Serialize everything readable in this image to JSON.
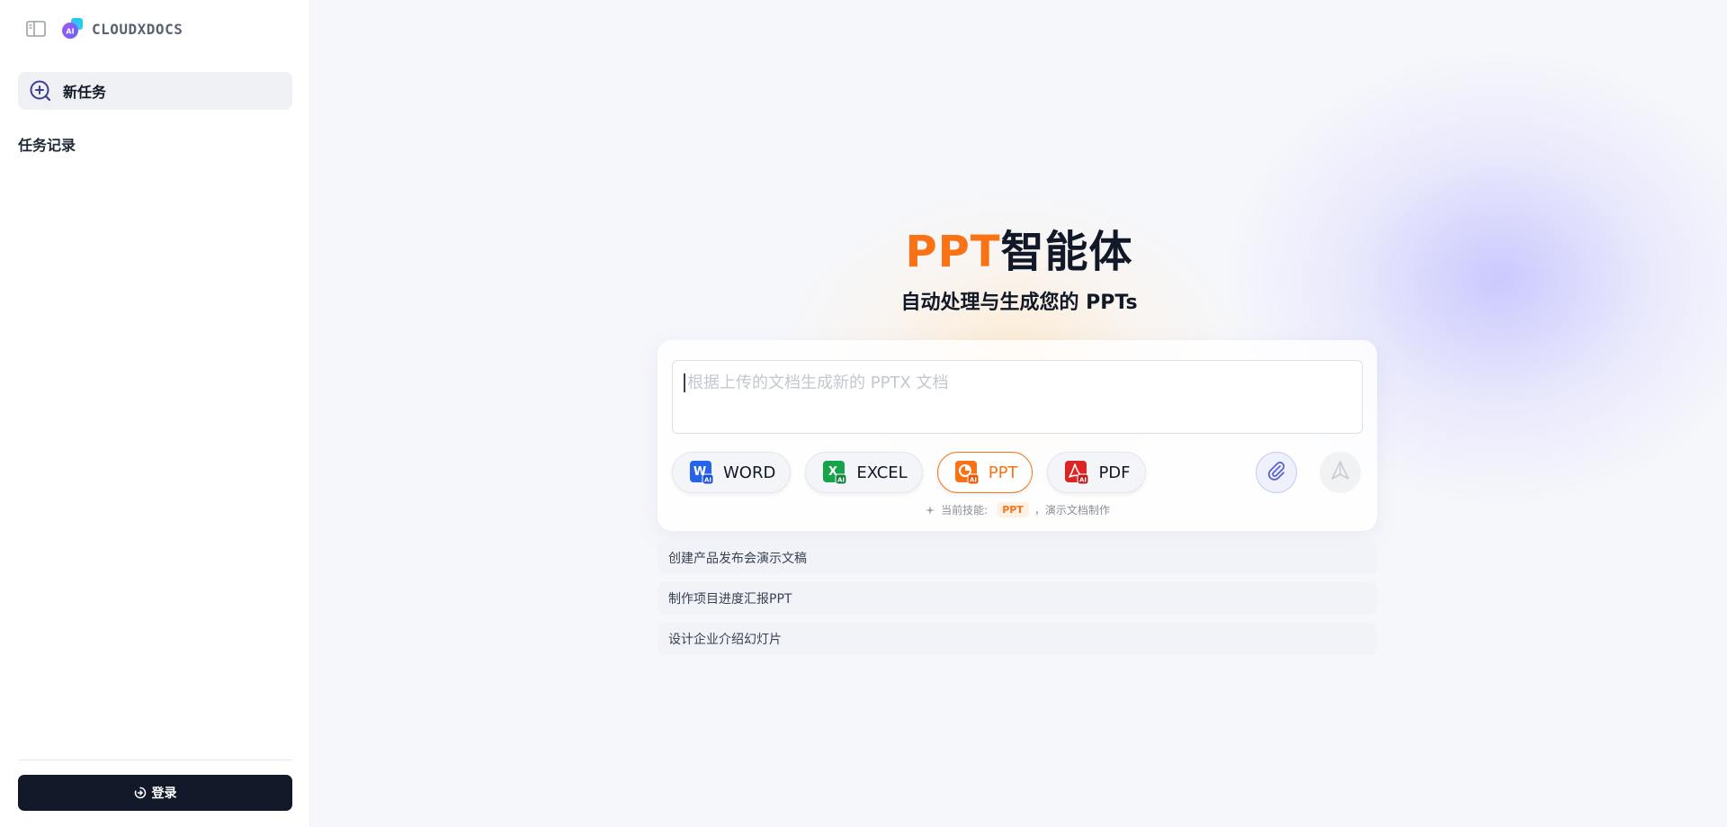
{
  "sidebar": {
    "brand": "CLOUDXDOCS",
    "new_task": "新任务",
    "history_title": "任务记录",
    "login": "登录"
  },
  "hero": {
    "title_accent": "PPT",
    "title_rest": "智能体",
    "subtitle": "自动处理与生成您的 PPTs"
  },
  "prompt": {
    "placeholder": "根据上传的文档生成新的 PPTX 文档",
    "value": ""
  },
  "skills": [
    {
      "label": "WORD",
      "icon": "word-ai-icon",
      "color": "#2563eb",
      "letter": "W",
      "active": false
    },
    {
      "label": "EXCEL",
      "icon": "excel-ai-icon",
      "color": "#16a34a",
      "letter": "X",
      "active": false
    },
    {
      "label": "PPT",
      "icon": "ppt-ai-icon",
      "color": "#f97316",
      "letter": "P",
      "active": true
    },
    {
      "label": "PDF",
      "icon": "pdf-ai-icon",
      "color": "#dc2626",
      "letter": "A",
      "active": false
    }
  ],
  "skill_hint": {
    "prefix": "当前技能:",
    "badge": "PPT",
    "separator": "，",
    "desc": "演示文档制作"
  },
  "suggestions": [
    "创建产品发布会演示文稿",
    "制作项目进度汇报PPT",
    "设计企业介绍幻灯片"
  ],
  "colors": {
    "accent": "#f97316",
    "dark": "#111827",
    "attach": "#6366f1"
  }
}
